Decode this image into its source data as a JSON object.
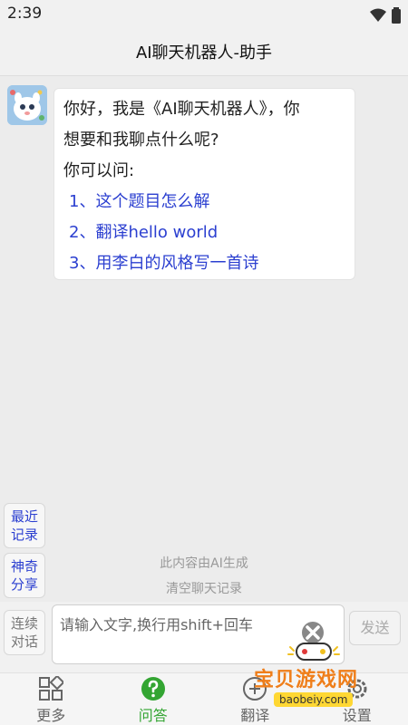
{
  "status": {
    "time": "2:39"
  },
  "header": {
    "title": "AI聊天机器人-助手"
  },
  "chat": {
    "message_lines": [
      "你好，我是《AI聊天机器人》，你",
      "想要和我聊点什么呢?",
      "你可以问:"
    ],
    "suggestions": [
      "1、这个题目怎么解",
      "2、翻译hello world",
      "3、用李白的风格写一首诗"
    ]
  },
  "side": {
    "recent_line1": "最近",
    "recent_line2": "记录",
    "share_line1": "神奇",
    "share_line2": "分享",
    "continuous_line1": "连续",
    "continuous_line2": "对话"
  },
  "notes": {
    "ai_generated": "此内容由AI生成",
    "clear_history": "清空聊天记录"
  },
  "input": {
    "placeholder": "请输入文字,换行用shift+回车",
    "send_label": "发送"
  },
  "tabs": [
    {
      "label": "更多",
      "icon": "grid-icon"
    },
    {
      "label": "问答",
      "icon": "question-icon"
    },
    {
      "label": "翻译",
      "icon": "translate-icon"
    },
    {
      "label": "设置",
      "icon": "settings-icon"
    }
  ],
  "colors": {
    "link": "#2b3fd0",
    "active_tab": "#33a532",
    "watermark": "#ef7e1a"
  },
  "watermark": {
    "text": "宝贝游戏网",
    "url": "baobeiy.com"
  }
}
